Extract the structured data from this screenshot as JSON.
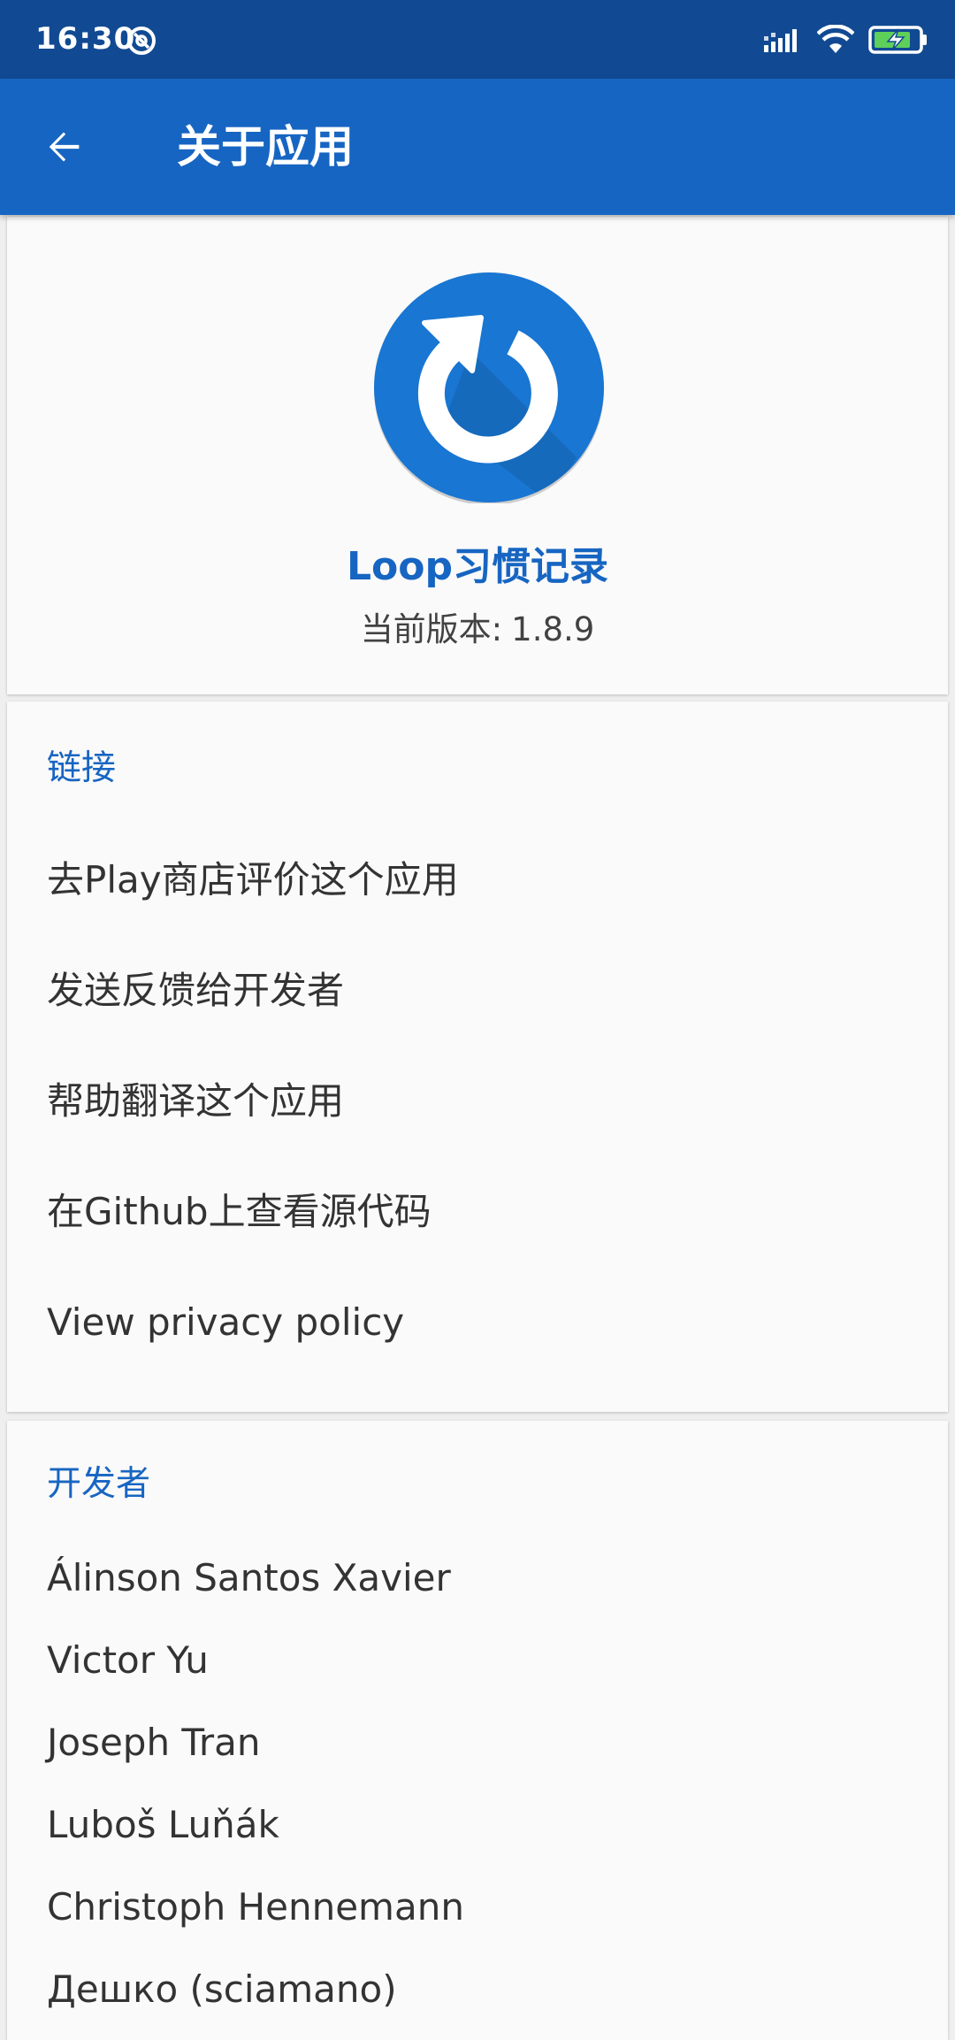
{
  "status_bar": {
    "time": "16:30",
    "icons": [
      "at-icon",
      "signal-icon",
      "wifi-icon",
      "battery-charging-icon"
    ]
  },
  "app_bar": {
    "back_icon": "arrow-left-icon",
    "title": "关于应用"
  },
  "header": {
    "logo_icon": "loop-refresh-icon",
    "app_name": "Loop习惯记录",
    "version_label": "当前版本:",
    "version": "1.8.9"
  },
  "links": {
    "title": "链接",
    "items": [
      "去Play商店评价这个应用",
      "发送反馈给开发者",
      "帮助翻译这个应用",
      "在Github上查看源代码",
      "View privacy policy"
    ]
  },
  "developers": {
    "title": "开发者",
    "items": [
      "Álinson Santos Xavier",
      "Victor Yu",
      "Joseph Tran",
      "Luboš Luňák",
      "Christoph Hennemann",
      "Дешко (sciamano)"
    ]
  },
  "colors": {
    "status_bar": "#114a93",
    "app_bar": "#1765c2",
    "accent": "#1765c2",
    "card_bg": "#fafafa",
    "page_bg": "#efefef",
    "text_primary": "#333333"
  }
}
